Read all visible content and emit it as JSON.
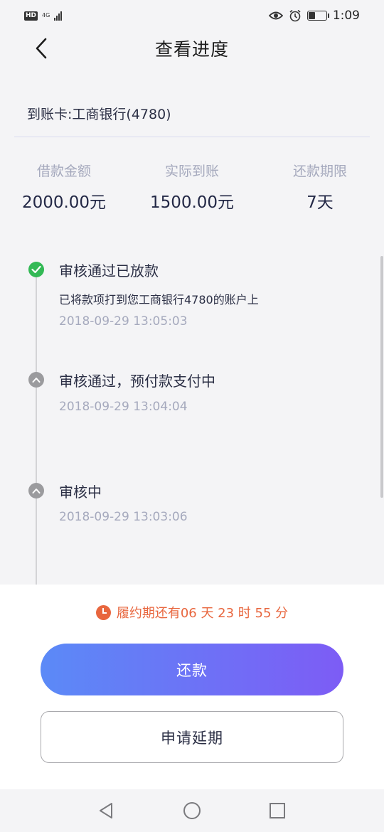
{
  "status_bar": {
    "network_badge": "HD",
    "network_type": "4G",
    "time": "1:09",
    "icons": [
      "eye-icon",
      "alarm-icon",
      "battery-icon"
    ]
  },
  "header": {
    "title": "查看进度",
    "back_icon": "chevron-left-icon"
  },
  "card": {
    "label": "到账卡:工商银行(4780)"
  },
  "stats": [
    {
      "label": "借款金额",
      "value": "2000.00元"
    },
    {
      "label": "实际到账",
      "value": "1500.00元"
    },
    {
      "label": "还款期限",
      "value": "7天"
    }
  ],
  "timeline": [
    {
      "title": "审核通过已放款",
      "desc": "已将款项打到您工商银行4780的账户上",
      "time": "2018-09-29 13:05:03",
      "status": "done",
      "icon": "check-icon"
    },
    {
      "title": "审核通过，预付款支付中",
      "desc": "",
      "time": "2018-09-29 13:04:04",
      "status": "waiting",
      "icon": "chevron-up-icon"
    },
    {
      "title": "审核中",
      "desc": "",
      "time": "2018-09-29 13:03:06",
      "status": "waiting",
      "icon": "chevron-up-icon"
    }
  ],
  "countdown": {
    "text": "履约期还有06 天 23 时 55 分",
    "icon": "clock-icon",
    "color": "#e8663e"
  },
  "buttons": {
    "repay": "还款",
    "extend": "申请延期"
  },
  "colors": {
    "accent_start": "#5b8af7",
    "accent_end": "#7d5cf5",
    "done": "#33b955",
    "waiting": "#9b9b9e"
  },
  "navbar": {
    "back": "triangle-back-icon",
    "home": "circle-home-icon",
    "recents": "square-recents-icon"
  }
}
